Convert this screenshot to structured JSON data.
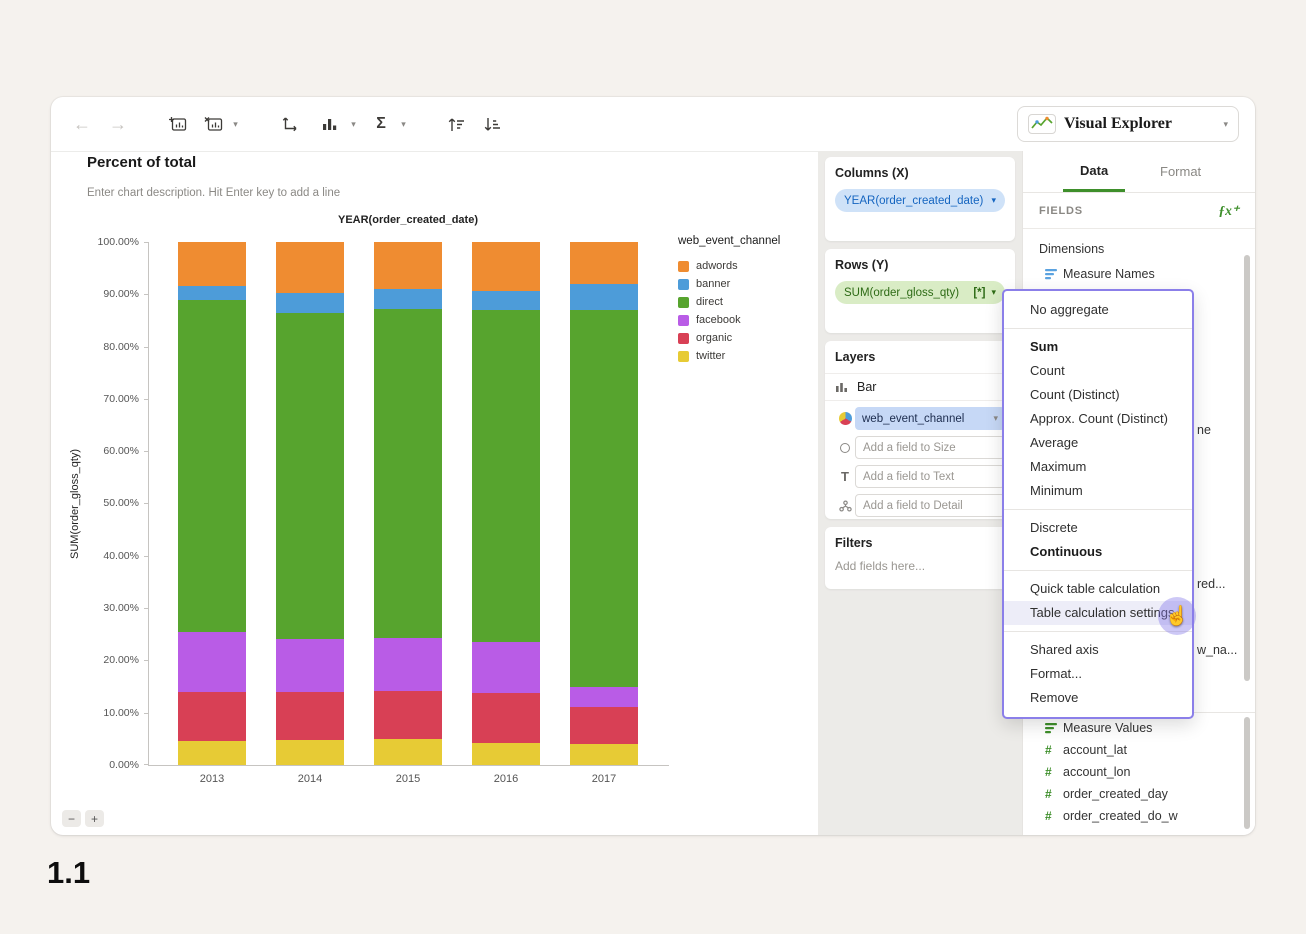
{
  "app": {
    "name": "Visual Explorer"
  },
  "page_label": "1.1",
  "icons": {
    "back_arrow": "←",
    "forward_arrow": "→",
    "chevron_down": "▾",
    "sigma": "Σ",
    "minus": "−",
    "plus": "+",
    "hash": "#",
    "fx": "ƒx⁺",
    "text_mark": "T",
    "pointer_hand": "☝"
  },
  "chart_header": {
    "title": "Percent of total",
    "description_placeholder": "Enter chart description. Hit Enter key to add a line"
  },
  "chart_data": {
    "type": "bar",
    "stacked": true,
    "percent_of_total": true,
    "title": "YEAR(order_created_date)",
    "ylabel": "SUM(order_gloss_qty)",
    "legend_title": "web_event_channel",
    "legend_position": "right",
    "grid": false,
    "categories": [
      "2013",
      "2014",
      "2015",
      "2016",
      "2017"
    ],
    "series": [
      {
        "name": "adwords",
        "color": "#ef8c31",
        "values": [
          8.5,
          9.7,
          9.0,
          9.3,
          8.0
        ]
      },
      {
        "name": "banner",
        "color": "#4d9cd9",
        "values": [
          2.5,
          3.8,
          3.8,
          3.7,
          5.0
        ]
      },
      {
        "name": "direct",
        "color": "#57a42e",
        "values": [
          63.5,
          62.5,
          63.0,
          63.5,
          72.0
        ]
      },
      {
        "name": "facebook",
        "color": "#b95ce6",
        "values": [
          11.5,
          10.0,
          10.0,
          9.7,
          4.0
        ]
      },
      {
        "name": "organic",
        "color": "#d84055",
        "values": [
          9.5,
          9.2,
          9.2,
          9.5,
          7.0
        ]
      },
      {
        "name": "twitter",
        "color": "#e7cb35",
        "values": [
          4.5,
          4.8,
          5.0,
          4.3,
          4.0
        ]
      }
    ],
    "stack_order_bottom_to_top": [
      "twitter",
      "organic",
      "facebook",
      "direct",
      "banner",
      "adwords"
    ],
    "ylim": [
      0,
      100
    ],
    "y_ticks": [
      "0.00%",
      "10.00%",
      "20.00%",
      "30.00%",
      "40.00%",
      "50.00%",
      "60.00%",
      "70.00%",
      "80.00%",
      "90.00%",
      "100.00%"
    ]
  },
  "shelves": {
    "columns": {
      "title": "Columns (X)",
      "pill": "YEAR(order_created_date)"
    },
    "rows": {
      "title": "Rows (Y)",
      "pill": "SUM(order_gloss_qty)",
      "pill_badge": "[*]"
    },
    "layers": {
      "title": "Layers",
      "mark_type": "Bar",
      "color_field": "web_event_channel",
      "size_placeholder": "Add a field to Size",
      "text_placeholder": "Add a field to Text",
      "detail_placeholder": "Add a field to Detail"
    },
    "filters": {
      "title": "Filters",
      "placeholder": "Add fields here..."
    }
  },
  "data_panel": {
    "tabs": [
      {
        "label": "Data",
        "active": true
      },
      {
        "label": "Format",
        "active": false
      }
    ],
    "fields_header": "FIELDS",
    "dimensions_label": "Dimensions",
    "dimension_fields": [
      {
        "name": "Measure Names",
        "icon": "measure-names-icon"
      }
    ],
    "obscured_field_fragments": [
      "ne",
      "red...",
      "w_na..."
    ],
    "measure_fields": [
      {
        "name": "Measure Values",
        "icon": "measure-values-icon"
      },
      {
        "name": "account_lat",
        "icon": "number-icon"
      },
      {
        "name": "account_lon",
        "icon": "number-icon"
      },
      {
        "name": "order_created_day",
        "icon": "number-icon"
      },
      {
        "name": "order_created_do_w",
        "icon": "number-icon"
      }
    ]
  },
  "context_menu": {
    "items": [
      {
        "label": "No aggregate"
      },
      {
        "type": "divider"
      },
      {
        "label": "Sum",
        "bold": true
      },
      {
        "label": "Count"
      },
      {
        "label": "Count (Distinct)"
      },
      {
        "label": "Approx. Count (Distinct)"
      },
      {
        "label": "Average"
      },
      {
        "label": "Maximum"
      },
      {
        "label": "Minimum"
      },
      {
        "type": "divider"
      },
      {
        "label": "Discrete"
      },
      {
        "label": "Continuous",
        "bold": true
      },
      {
        "type": "divider"
      },
      {
        "label": "Quick table calculation"
      },
      {
        "label": "Table calculation settings",
        "hovered": true
      },
      {
        "type": "divider"
      },
      {
        "label": "Shared axis"
      },
      {
        "label": "Format..."
      },
      {
        "label": "Remove"
      }
    ],
    "cursor_on": "Table calculation settings"
  },
  "colors": {
    "accent_green": "#3e8f2b",
    "menu_border": "#8b7fe9",
    "columns_pill_bg": "#cfe2f8",
    "rows_pill_bg": "#d9ecc5",
    "layer_pill_bg": "#c6d8f6",
    "panel_bg": "#ecebe8"
  }
}
